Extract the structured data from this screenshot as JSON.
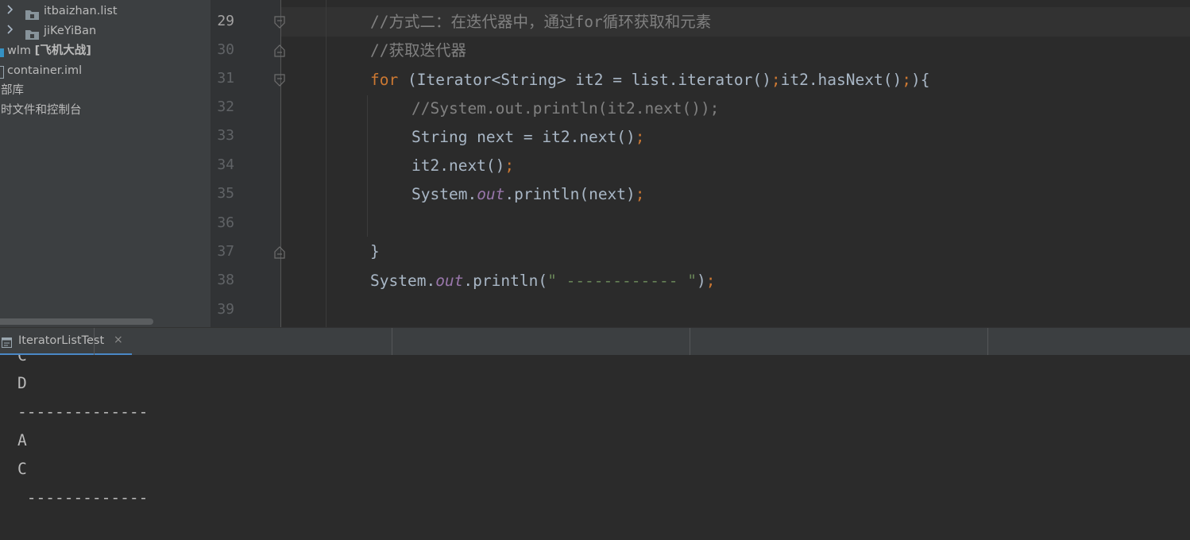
{
  "project_tree": {
    "items": [
      {
        "name": "itbaizhan.list",
        "type": "folder"
      },
      {
        "name": "jiKeYiBan",
        "type": "folder"
      },
      {
        "name": "wlm",
        "suffix": "[飞机大战]",
        "type": "module"
      },
      {
        "name": "container.iml",
        "type": "file"
      },
      {
        "name": "部库",
        "type": "node"
      },
      {
        "name": "时文件和控制台",
        "type": "node"
      }
    ]
  },
  "editor": {
    "current_line": "29",
    "lines": [
      {
        "num": "29",
        "tokens": [
          {
            "t": "//方式二：在迭代器中，通过for循环获取和元素",
            "c": "c-cmt"
          }
        ]
      },
      {
        "num": "30",
        "tokens": [
          {
            "t": "//获取迭代器",
            "c": "c-cmt"
          }
        ]
      },
      {
        "num": "31",
        "tokens": [
          {
            "t": "for",
            "c": "c-kw"
          },
          {
            "t": " (Iterator<String> it2 = list.iterator()"
          },
          {
            "t": ";",
            "c": "c-pun"
          },
          {
            "t": "it2.hasNext()"
          },
          {
            "t": ";",
            "c": "c-pun"
          },
          {
            "t": "){"
          }
        ]
      },
      {
        "num": "32",
        "tokens": [
          {
            "t": "//System.out.println(it2.next());",
            "c": "c-cmt"
          }
        ]
      },
      {
        "num": "33",
        "tokens": [
          {
            "t": "String next = it2.next()"
          },
          {
            "t": ";",
            "c": "c-pun"
          }
        ]
      },
      {
        "num": "34",
        "tokens": [
          {
            "t": "it2.next()"
          },
          {
            "t": ";",
            "c": "c-pun"
          }
        ]
      },
      {
        "num": "35",
        "tokens": [
          {
            "t": "System."
          },
          {
            "t": "out",
            "c": "c-fld"
          },
          {
            "t": ".println(next)"
          },
          {
            "t": ";",
            "c": "c-pun"
          }
        ]
      },
      {
        "num": "36",
        "tokens": []
      },
      {
        "num": "37",
        "tokens": [
          {
            "t": "}"
          }
        ]
      },
      {
        "num": "38",
        "tokens": [
          {
            "t": "System."
          },
          {
            "t": "out",
            "c": "c-fld"
          },
          {
            "t": ".println("
          },
          {
            "t": "\" ------------ \"",
            "c": "c-str"
          },
          {
            "t": ")"
          },
          {
            "t": ";",
            "c": "c-pun"
          }
        ]
      },
      {
        "num": "39",
        "tokens": []
      }
    ]
  },
  "run_panel": {
    "tab_label": "IteratorListTest",
    "close_glyph": "×",
    "console_lines": [
      "C",
      "D",
      "--------------",
      "A",
      "C",
      " -------------"
    ]
  },
  "colors": {
    "keyword": "#cc7832",
    "comment": "#808080",
    "string": "#6a8759",
    "field": "#9876aa",
    "text": "#a9b7c6",
    "accent": "#4a88c7"
  }
}
